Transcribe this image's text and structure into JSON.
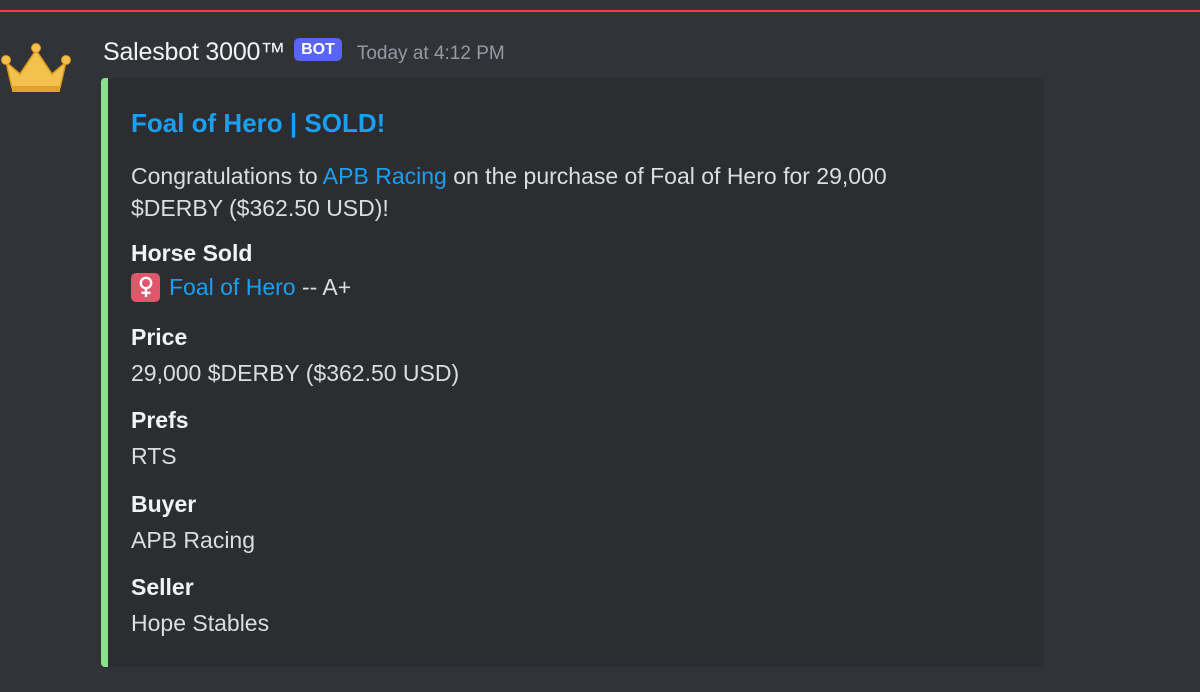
{
  "message": {
    "author": "Salesbot 3000™",
    "badge": "BOT",
    "timestamp": "Today at 4:12 PM",
    "avatar_icon": "crown-icon"
  },
  "embed": {
    "accent_color": "#89e38b",
    "title": "Foal of Hero | SOLD!",
    "description": {
      "prefix": "Congratulations to ",
      "buyer_link": "APB Racing",
      "suffix": " on the purchase of Foal of Hero for 29,000 $DERBY ($362.50 USD)!"
    },
    "fields": {
      "horse_sold": {
        "name": "Horse Sold",
        "icon": "female-sign-icon",
        "horse_link": "Foal of Hero",
        "grade": " -- A+"
      },
      "price": {
        "name": "Price",
        "value": "29,000 $DERBY ($362.50 USD)"
      },
      "prefs": {
        "name": "Prefs",
        "value": "RTS"
      },
      "buyer": {
        "name": "Buyer",
        "value": "APB Racing"
      },
      "seller": {
        "name": "Seller",
        "value": "Hope Stables"
      }
    }
  }
}
